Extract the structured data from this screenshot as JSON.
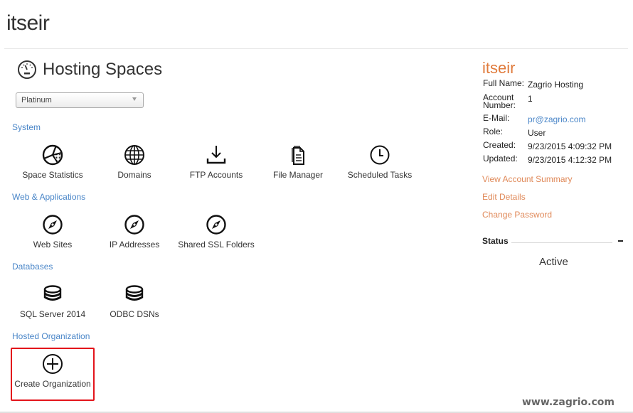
{
  "page": {
    "title": "itseir"
  },
  "hosting_spaces": {
    "title": "Hosting Spaces",
    "icon": "gauge-icon",
    "plan_select": {
      "selected": "Platinum"
    }
  },
  "groups": [
    {
      "label": "System",
      "items": [
        {
          "label": "Space Statistics",
          "icon": "pie-chart-icon"
        },
        {
          "label": "Domains",
          "icon": "globe-icon"
        },
        {
          "label": "FTP Accounts",
          "icon": "download-icon"
        },
        {
          "label": "File Manager",
          "icon": "documents-icon"
        },
        {
          "label": "Scheduled Tasks",
          "icon": "clock-icon"
        }
      ]
    },
    {
      "label": "Web & Applications",
      "items": [
        {
          "label": "Web Sites",
          "icon": "compass-icon"
        },
        {
          "label": "IP Addresses",
          "icon": "compass-icon"
        },
        {
          "label": "Shared SSL Folders",
          "icon": "compass-icon"
        }
      ]
    },
    {
      "label": "Databases",
      "items": [
        {
          "label": "SQL Server 2014",
          "icon": "database-icon"
        },
        {
          "label": "ODBC DSNs",
          "icon": "database-icon"
        }
      ]
    },
    {
      "label": "Hosted Organization",
      "items": [
        {
          "label": "Create Organization",
          "icon": "plus-circle-icon",
          "highlighted": true
        }
      ]
    }
  ],
  "account": {
    "name": "itseir",
    "fields": {
      "full_name": {
        "label": "Full Name:",
        "value": "Zagrio Hosting"
      },
      "account_number": {
        "label": "Account Number:",
        "value": "1"
      },
      "email": {
        "label": "E-Mail:",
        "value": "pr@zagrio.com"
      },
      "role": {
        "label": "Role:",
        "value": "User"
      },
      "created": {
        "label": "Created:",
        "value": "9/23/2015 4:09:32 PM"
      },
      "updated": {
        "label": "Updated:",
        "value": "9/23/2015 4:12:32 PM"
      }
    },
    "links": {
      "view_summary": "View Account Summary",
      "edit_details": "Edit Details",
      "change_password": "Change Password"
    },
    "status": {
      "label": "Status",
      "value": "Active"
    }
  },
  "colors": {
    "accent_orange": "#e07b3c",
    "link_blue": "#4a86c8",
    "highlight_red": "#e3141b"
  },
  "watermark": "www.zagrio.com"
}
